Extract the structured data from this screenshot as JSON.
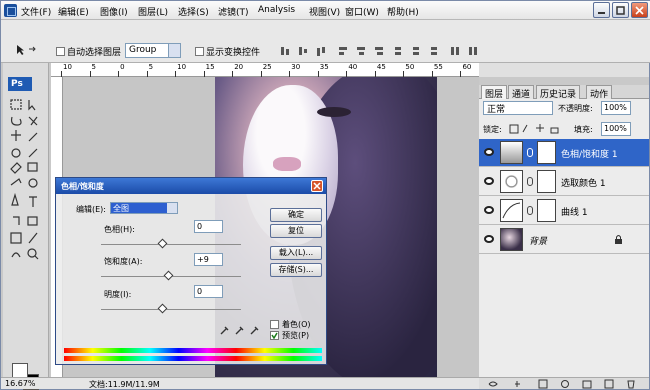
{
  "menubar": {
    "items": [
      "文件(F)",
      "编辑(E)",
      "图像(I)",
      "图层(L)",
      "选择(S)",
      "滤镜(T)",
      "Analysis",
      "视图(V)",
      "窗口(W)",
      "帮助(H)"
    ]
  },
  "options": {
    "auto_select_label": "自动选择图层",
    "group_value": "Group",
    "show_transform_label": "显示变换控件"
  },
  "toolbar": {
    "logo": "Ps"
  },
  "ruler": {
    "top_numbers": [
      "10",
      "5",
      "0",
      "5",
      "10",
      "15",
      "20",
      "25",
      "30",
      "35",
      "40",
      "45",
      "50",
      "55",
      "60"
    ]
  },
  "status": {
    "zoom": "16.67%",
    "doc_info": "文档:11.9M/11.9M"
  },
  "dialog": {
    "title": "色相/饱和度",
    "edit_label": "编辑(E):",
    "edit_value": "全图",
    "hue_label": "色相(H):",
    "hue_value": "0",
    "saturation_label": "饱和度(A):",
    "saturation_value": "+9",
    "lightness_label": "明度(I):",
    "lightness_value": "0",
    "ok": "确定",
    "reset": "复位",
    "load": "载入(L)...",
    "save": "存储(S)...",
    "colorize": "着色(O)",
    "preview": "预览(P)",
    "slider_levels": {
      "hue": 0,
      "saturation": 9,
      "lightness": 0
    }
  },
  "panels": {
    "tabs": [
      "图层",
      "通道",
      "历史记录",
      "动作"
    ],
    "blend_mode": "正常",
    "opacity_label": "不透明度:",
    "opacity_value": "100%",
    "lock_label": "锁定:",
    "fill_label": "填充:",
    "fill_value": "100%",
    "layers": [
      {
        "name": "色相/饱和度 1",
        "selected": true
      },
      {
        "name": "选取颜色 1",
        "selected": false
      },
      {
        "name": "曲线 1",
        "selected": false
      },
      {
        "name": "背景",
        "selected": false
      }
    ]
  },
  "colors": {
    "selected_layer": "#2f65c8",
    "dialog_title": "#1b4ba8",
    "accent": "#1f5bb3"
  }
}
